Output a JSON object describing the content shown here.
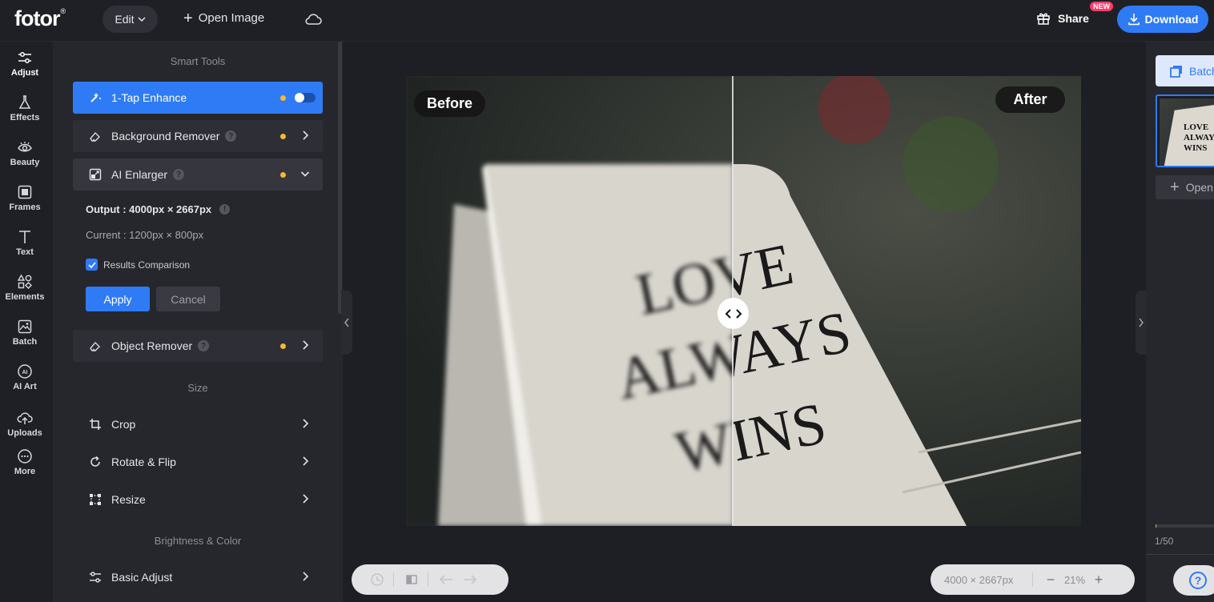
{
  "header": {
    "logo": "fotor",
    "logo_mark": "®",
    "edit_label": "Edit",
    "open_image_label": "Open Image",
    "share_label": "Share",
    "new_badge": "NEW",
    "download_label": "Download"
  },
  "rail": {
    "items": [
      {
        "label": "Adjust",
        "icon": "sliders-icon"
      },
      {
        "label": "Effects",
        "icon": "flask-icon"
      },
      {
        "label": "Beauty",
        "icon": "eye-icon"
      },
      {
        "label": "Frames",
        "icon": "frame-icon"
      },
      {
        "label": "Text",
        "icon": "text-icon"
      },
      {
        "label": "Elements",
        "icon": "shapes-icon"
      },
      {
        "label": "Batch",
        "icon": "batch-icon"
      },
      {
        "label": "AI Art",
        "icon": "ai-icon"
      },
      {
        "label": "Uploads",
        "icon": "upload-icon"
      },
      {
        "label": "More",
        "icon": "more-icon"
      }
    ]
  },
  "panel": {
    "smart_tools_title": "Smart Tools",
    "one_tap": "1-Tap Enhance",
    "bg_remover": "Background Remover",
    "ai_enlarger": "AI Enlarger",
    "output": "Output : 4000px × 2667px",
    "current": "Current : 1200px × 800px",
    "results_comparison": "Results Comparison",
    "apply": "Apply",
    "cancel": "Cancel",
    "object_remover": "Object Remover",
    "size_title": "Size",
    "crop": "Crop",
    "rotate_flip": "Rotate & Flip",
    "resize": "Resize",
    "brightness_title": "Brightness & Color",
    "basic_adjust": "Basic Adjust"
  },
  "canvas": {
    "before_label": "Before",
    "after_label": "After",
    "photo_text": [
      "LOVE",
      "ALWAYS",
      "WINS"
    ]
  },
  "bottom": {
    "dimensions": "4000 × 2667px",
    "zoom": "21%",
    "zoom_out": "−",
    "zoom_in": "+"
  },
  "right_panel": {
    "batch_label": "Batch",
    "open_label": "Open",
    "count": "1/50",
    "progress_fraction": 0.02
  },
  "colors": {
    "accent": "#2f7bf6",
    "status_dot": "#f5b82e",
    "new_badge": "#ff3d6a"
  }
}
